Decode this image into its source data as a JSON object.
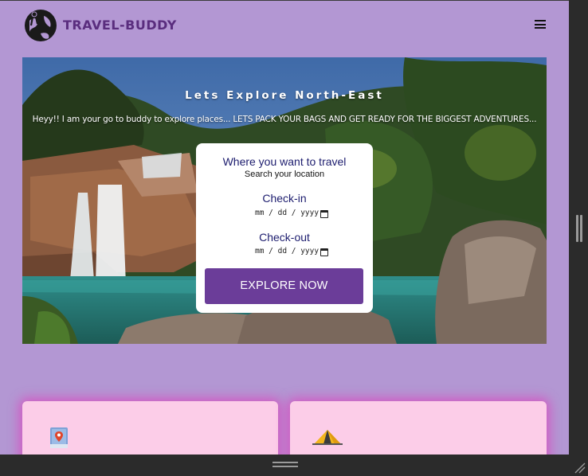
{
  "navbar": {
    "brand": "TRAVEL-BUDDY",
    "logo_icon": "globe-traveler-icon",
    "menu_icon": "hamburger-menu-icon"
  },
  "hero": {
    "title": "Lets Explore North-East",
    "subtitle": "Heyy!! I am your go to buddy to explore places... LETS PACK YOUR BAGS AND GET READY FOR THE BIGGEST ADVENTURES...",
    "background": "waterfall-landscape-image"
  },
  "search_card": {
    "heading": "Where you want to travel",
    "subheading": "Search your location",
    "checkin_label": "Check-in",
    "checkin_value": "mm / dd / yyyy",
    "checkout_label": "Check-out",
    "checkout_value": "mm / dd / yyyy",
    "button_label": "EXPLORE NOW"
  },
  "features": [
    {
      "icon": "map-pin-book-icon"
    },
    {
      "icon": "camping-tent-icon"
    }
  ],
  "colors": {
    "page_bg": "#b397d3",
    "brand": "#5a2d7e",
    "button": "#6b3d99",
    "feature_card": "#fccde8",
    "feature_glow": "#dc46be"
  }
}
